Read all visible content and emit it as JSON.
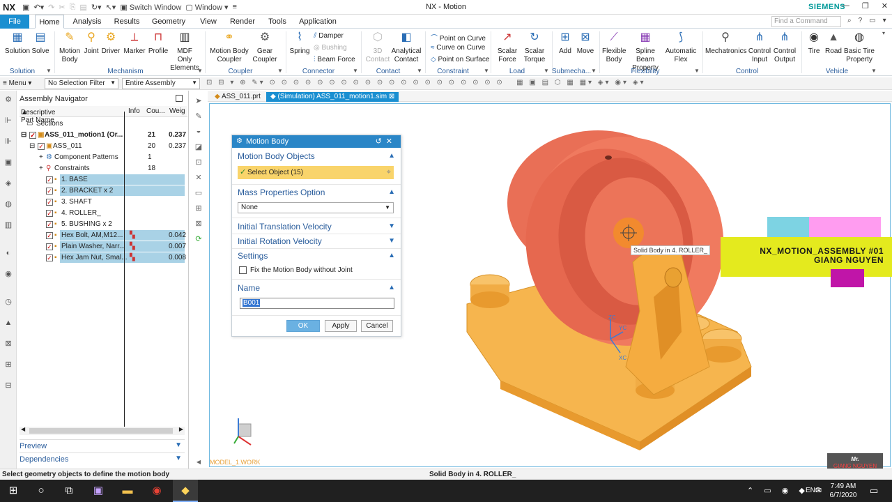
{
  "titlebar": {
    "logo": "NX",
    "title": "NX - Motion",
    "brand": "SIEMENS",
    "switch_window": "Switch Window",
    "window": "Window"
  },
  "tabs": {
    "file": "File",
    "items": [
      "Home",
      "Analysis",
      "Results",
      "Geometry",
      "View",
      "Render",
      "Tools",
      "Application"
    ],
    "active": "Home",
    "search_placeholder": "Find a Command"
  },
  "ribbon": {
    "solution": {
      "label": "Solution",
      "items": [
        "Solution",
        "Solve"
      ]
    },
    "mechanism": {
      "label": "Mechanism",
      "items": [
        "Motion Body",
        "Joint",
        "Driver",
        "Marker",
        "Profile",
        "MDF Only Elements"
      ]
    },
    "coupler": {
      "label": "Coupler",
      "items": [
        "Motion Body Coupler",
        "Gear Coupler"
      ]
    },
    "connector": {
      "label": "Connector",
      "spring": "Spring",
      "damper": "Damper",
      "bushing": "Bushing",
      "beam_force": "Beam Force"
    },
    "contact": {
      "label": "Contact",
      "items": [
        "3D Contact",
        "Analytical Contact"
      ]
    },
    "constraint": {
      "label": "Constraint",
      "items": [
        "Point on Curve",
        "Curve on Curve",
        "Point on Surface"
      ]
    },
    "load": {
      "label": "Load",
      "items": [
        "Scalar Force",
        "Scalar Torque"
      ]
    },
    "submechanism": {
      "label": "Submecha...",
      "items": [
        "Add",
        "Move"
      ]
    },
    "flexibility": {
      "label": "Flexibility",
      "items": [
        "Flexible Body",
        "Spline Beam Property",
        "Automatic Flex"
      ]
    },
    "control": {
      "label": "Control",
      "items": [
        "Mechatronics",
        "Control Input",
        "Control Output"
      ]
    },
    "vehicle": {
      "label": "Vehicle",
      "items": [
        "Tire",
        "Road",
        "Basic Tire Property"
      ]
    }
  },
  "selbar": {
    "menu": "Menu",
    "filter": "No Selection Filter",
    "scope": "Entire Assembly"
  },
  "navigator": {
    "title": "Assembly Navigator",
    "columns": [
      "Descriptive Part Name",
      "Info",
      "Cou...",
      "Weig"
    ],
    "rows": [
      {
        "name": "Sections",
        "count": "",
        "weight": ""
      },
      {
        "name": "ASS_011_motion1 (Or...",
        "count": "21",
        "weight": "0.237"
      },
      {
        "name": "ASS_011",
        "count": "20",
        "weight": "0.237"
      },
      {
        "name": "Component Patterns",
        "count": "1",
        "weight": ""
      },
      {
        "name": "Constraints",
        "count": "18",
        "weight": ""
      },
      {
        "name": "1. BASE",
        "count": "",
        "weight": ""
      },
      {
        "name": "2. BRACKET x 2",
        "count": "",
        "weight": ""
      },
      {
        "name": "3. SHAFT",
        "count": "",
        "weight": ""
      },
      {
        "name": "4. ROLLER_",
        "count": "",
        "weight": ""
      },
      {
        "name": "5. BUSHING x 2",
        "count": "",
        "weight": ""
      },
      {
        "name": "Hex Bolt, AM,M12...",
        "count": "",
        "weight": "0.042"
      },
      {
        "name": "Plain Washer, Narr...",
        "count": "",
        "weight": "0.007"
      },
      {
        "name": "Hex Jam Nut, Smal...",
        "count": "",
        "weight": "0.008"
      }
    ],
    "preview": "Preview",
    "dependencies": "Dependencies"
  },
  "doctabs": [
    "ASS_011.prt",
    "(Simulation) ASS_011_motion1.sim"
  ],
  "dialog": {
    "title": "Motion Body",
    "sec_objects": "Motion Body Objects",
    "select_object": "Select Object (15)",
    "sec_mass": "Mass Properties Option",
    "mass_value": "None",
    "sec_trans": "Initial Translation Velocity",
    "sec_rot": "Initial Rotation Velocity",
    "sec_settings": "Settings",
    "fix_label": "Fix the Motion Body without Joint",
    "sec_name": "Name",
    "name_value": "B001",
    "ok": "OK",
    "apply": "Apply",
    "cancel": "Cancel"
  },
  "viewport": {
    "tooltip": "Solid Body in 4. ROLLER_",
    "wcs_label": "MODEL_1.WORK",
    "axis_labels": [
      "ZC",
      "YC",
      "XC"
    ]
  },
  "overlay": {
    "line1": "NX_MOTION_ASSEMBLY #01",
    "line2": "GIANG NGUYEN",
    "brand_line1": "Mr.",
    "brand_line2": "GIANG NGUYEN",
    "colors": {
      "cyan": "#7dd3e3",
      "pink": "#ff9cf0",
      "magenta": "#c015a8",
      "banner": "#e4ea1e"
    }
  },
  "status": {
    "left": "Select geometry objects to define the motion body",
    "center": "Solid Body in 4. ROLLER_"
  },
  "taskbar": {
    "lang": "ENG",
    "time": "7:49 AM",
    "date": "6/7/2020"
  },
  "colors": {
    "accent": "#1a8fd1",
    "selection": "#a9d2e6",
    "roller": "#e96f56",
    "base": "#f6b54e"
  }
}
